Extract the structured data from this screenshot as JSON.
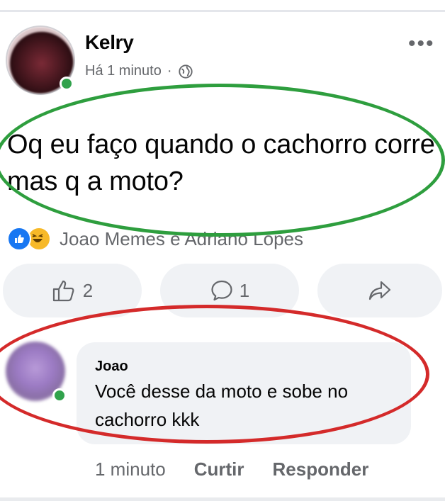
{
  "post": {
    "author": "Kelry",
    "timestamp": "Há 1 minuto",
    "separator": "·",
    "privacy_icon": "globe-icon",
    "more_icon": "more-horizontal-icon",
    "text": "Oq eu faço quando o cachorro corre mas q a moto?",
    "reactions": {
      "icons": [
        "like-reaction-icon",
        "haha-reaction-icon"
      ],
      "names": "Joao Memes e Adriano Lopes"
    }
  },
  "actions": {
    "like_count": "2",
    "comment_count": "1",
    "share_icon": "share-arrow-icon"
  },
  "comment": {
    "author": "Joao",
    "text": "Você desse da moto e sobe no cachorro kkk",
    "time": "1 minuto",
    "like_label": "Curtir",
    "reply_label": "Responder"
  },
  "colors": {
    "facebook_blue": "#1877f2",
    "online_green": "#31a24c",
    "annotation_green": "#2e9e3e",
    "annotation_red": "#d42a2a",
    "bubble_bg": "#f0f2f5",
    "secondary_text": "#65676b"
  }
}
